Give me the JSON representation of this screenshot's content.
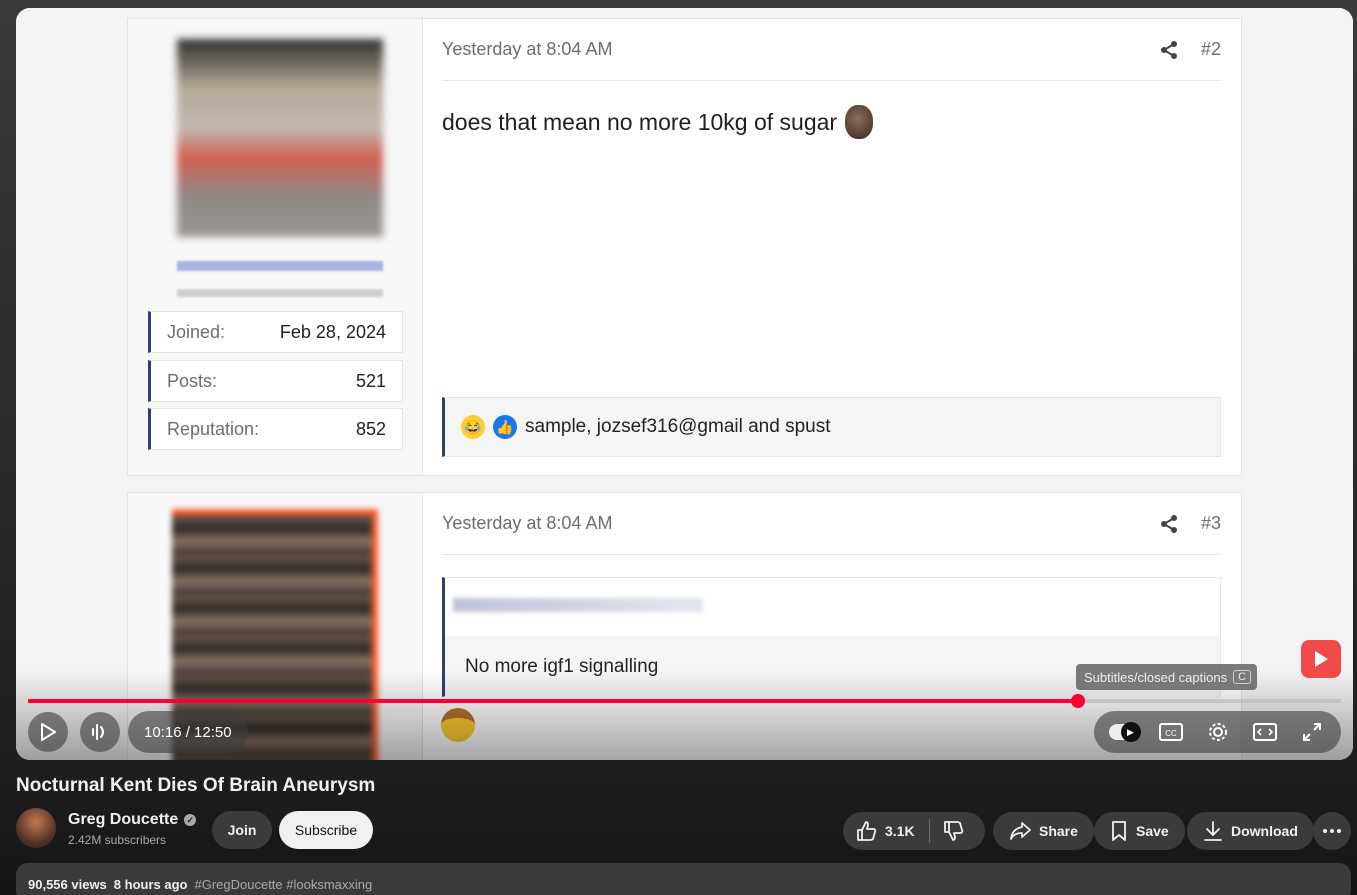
{
  "posts": [
    {
      "timestamp": "Yesterday at 8:04 AM",
      "number": "#2",
      "body": "does that mean no more 10kg of sugar",
      "stats": [
        {
          "label": "Joined:",
          "value": "Feb 28, 2024"
        },
        {
          "label": "Posts:",
          "value": "521"
        },
        {
          "label": "Reputation:",
          "value": "852"
        }
      ],
      "reactions": "sample, jozsef316@gmail and spust"
    },
    {
      "timestamp": "Yesterday at 8:04 AM",
      "number": "#3",
      "quote": "No more igf1 signalling"
    }
  ],
  "player": {
    "time": "10:16 / 12:50",
    "progress_fraction": 0.8,
    "tooltip": "Subtitles/closed captions",
    "tooltip_key": "C"
  },
  "video": {
    "title": "Nocturnal Kent Dies Of Brain Aneurysm",
    "channel": "Greg Doucette",
    "subscribers": "2.42M subscribers",
    "join_label": "Join",
    "subscribe_label": "Subscribe",
    "likes": "3.1K",
    "share_label": "Share",
    "save_label": "Save",
    "download_label": "Download",
    "views": "90,556 views",
    "posted": "8 hours ago",
    "tags": "#GregDoucette #looksmaxxing"
  }
}
